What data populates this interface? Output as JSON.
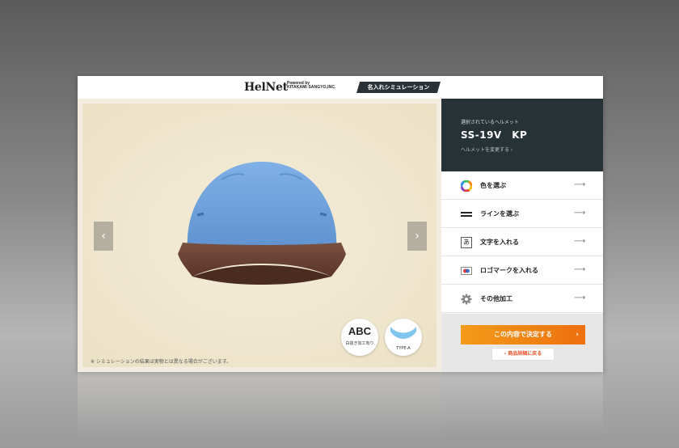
{
  "header": {
    "logo": "HelNet",
    "powered_line1": "Powered by",
    "powered_line2": "KITAKAMI SANGYO,INC.",
    "badge": "名入れシミュレーション"
  },
  "preview": {
    "prev_arrow": "‹",
    "next_arrow": "›",
    "option_abc": "ABC",
    "option_abc_label": "白抜き加工有り",
    "option_type_label": "TYPE-A",
    "note": "※ シミュレーションの結果は実物とは異なる場合がございます。",
    "helmet_shell_color": "#6c9fd9",
    "helmet_brim_color": "#6b4332"
  },
  "selection": {
    "caption": "選択されているヘルメット",
    "model": "SS-19V　KP",
    "change_link": "ヘルメットを変更する ›"
  },
  "menu": [
    {
      "label": "色を選ぶ",
      "icon": "color-wheel-icon",
      "arrow": "⟶"
    },
    {
      "label": "ラインを選ぶ",
      "icon": "line-icon",
      "arrow": "⟶"
    },
    {
      "label": "文字を入れる",
      "icon": "text-icon",
      "icon_text": "あ",
      "arrow": "⟶"
    },
    {
      "label": "ロゴマークを入れる",
      "icon": "logo-mark-icon",
      "arrow": "⟶"
    },
    {
      "label": "その他加工",
      "icon": "gear-icon",
      "arrow": "⟶"
    }
  ],
  "actions": {
    "decide": "この内容で決定する",
    "decide_chevron": "›",
    "back": "‹ 商品詳細に戻る"
  },
  "colors": {
    "accent": "#ee6f0e",
    "dark": "#273237"
  }
}
